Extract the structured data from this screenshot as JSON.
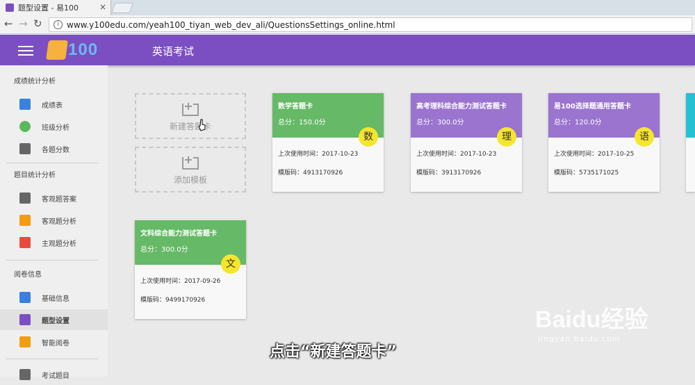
{
  "browser": {
    "tab_title": "题型设置 - 易100",
    "url": "www.y100edu.com/yeah100_tiyan_web_dev_ali/QuestionsSettings_online.html"
  },
  "header": {
    "logo_text": "100",
    "title": "英语考试",
    "color": "#7b4fc1"
  },
  "sidebar": {
    "sections": [
      {
        "title": "成绩统计分析",
        "items": [
          {
            "label": "成绩表",
            "icon": "clipboard-icon",
            "color": "#3a80e0"
          },
          {
            "label": "班级分析",
            "icon": "users-icon",
            "color": "#5cb85c"
          },
          {
            "label": "各题分数",
            "icon": "document-icon",
            "color": "#666666"
          }
        ]
      },
      {
        "title": "题目统计分析",
        "items": [
          {
            "label": "客观题答案",
            "icon": "comment-icon",
            "color": "#666666"
          },
          {
            "label": "客观题分析",
            "icon": "abcd-icon",
            "color": "#f39c12"
          },
          {
            "label": "主观题分析",
            "icon": "list-icon",
            "color": "#e74c3c"
          }
        ]
      },
      {
        "title": "阅卷信息",
        "items": [
          {
            "label": "基础信息",
            "icon": "info-list-icon",
            "color": "#3a80e0"
          },
          {
            "label": "题型设置",
            "icon": "sort-icon",
            "color": "#7b4fc1",
            "active": true
          },
          {
            "label": "智能阅卷",
            "icon": "bag-icon",
            "color": "#f39c12"
          },
          {
            "label": "考试题目",
            "icon": "exam-icon",
            "color": "#666666"
          }
        ]
      }
    ]
  },
  "actions": {
    "new_card_label": "新建答题卡",
    "add_template_label": "添加模板"
  },
  "cards": [
    {
      "title": "数学答题卡",
      "score": "总分：150.0分",
      "badge": "数",
      "last_used": "上次使用时间：2017-10-23",
      "template_code": "模版码：4913170926",
      "color": "#66b966"
    },
    {
      "title": "高考理科综合能力测试答题卡",
      "score": "总分：300.0分",
      "badge": "理",
      "last_used": "上次使用时间：2017-10-23",
      "template_code": "模版码：3913170926",
      "color": "#9a74cf"
    },
    {
      "title": "易100选择题通用答题卡",
      "score": "总分：120.0分",
      "badge": "语",
      "last_used": "上次使用时间：2017-10-25",
      "template_code": "模版码：5735171025",
      "color": "#9a74cf"
    },
    {
      "title": "文科综合能力测试答题卡",
      "score": "总分：300.0分",
      "badge": "文",
      "last_used": "上次使用时间：2017-09-26",
      "template_code": "模版码：9499170926",
      "color": "#66b966"
    }
  ],
  "overlay": {
    "subtitle": "点击“新建答题卡”",
    "watermark_main": "Baidu经验",
    "watermark_sub": "jingyan.baidu.com"
  }
}
